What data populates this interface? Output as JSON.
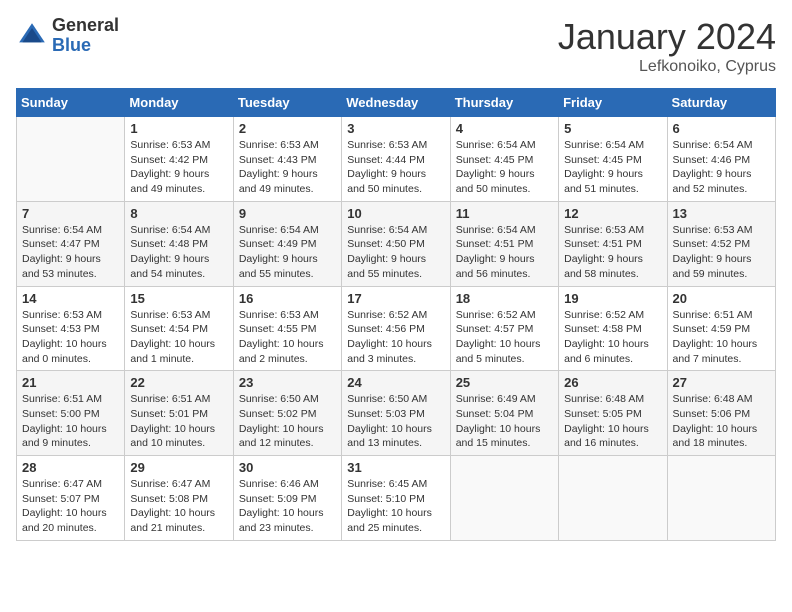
{
  "header": {
    "logo_general": "General",
    "logo_blue": "Blue",
    "month_title": "January 2024",
    "location": "Lefkonoiko, Cyprus"
  },
  "weekdays": [
    "Sunday",
    "Monday",
    "Tuesday",
    "Wednesday",
    "Thursday",
    "Friday",
    "Saturday"
  ],
  "weeks": [
    [
      {
        "day": "",
        "empty": true
      },
      {
        "day": "1",
        "sunrise": "Sunrise: 6:53 AM",
        "sunset": "Sunset: 4:42 PM",
        "daylight": "Daylight: 9 hours and 49 minutes."
      },
      {
        "day": "2",
        "sunrise": "Sunrise: 6:53 AM",
        "sunset": "Sunset: 4:43 PM",
        "daylight": "Daylight: 9 hours and 49 minutes."
      },
      {
        "day": "3",
        "sunrise": "Sunrise: 6:53 AM",
        "sunset": "Sunset: 4:44 PM",
        "daylight": "Daylight: 9 hours and 50 minutes."
      },
      {
        "day": "4",
        "sunrise": "Sunrise: 6:54 AM",
        "sunset": "Sunset: 4:45 PM",
        "daylight": "Daylight: 9 hours and 50 minutes."
      },
      {
        "day": "5",
        "sunrise": "Sunrise: 6:54 AM",
        "sunset": "Sunset: 4:45 PM",
        "daylight": "Daylight: 9 hours and 51 minutes."
      },
      {
        "day": "6",
        "sunrise": "Sunrise: 6:54 AM",
        "sunset": "Sunset: 4:46 PM",
        "daylight": "Daylight: 9 hours and 52 minutes."
      }
    ],
    [
      {
        "day": "7",
        "sunrise": "Sunrise: 6:54 AM",
        "sunset": "Sunset: 4:47 PM",
        "daylight": "Daylight: 9 hours and 53 minutes."
      },
      {
        "day": "8",
        "sunrise": "Sunrise: 6:54 AM",
        "sunset": "Sunset: 4:48 PM",
        "daylight": "Daylight: 9 hours and 54 minutes."
      },
      {
        "day": "9",
        "sunrise": "Sunrise: 6:54 AM",
        "sunset": "Sunset: 4:49 PM",
        "daylight": "Daylight: 9 hours and 55 minutes."
      },
      {
        "day": "10",
        "sunrise": "Sunrise: 6:54 AM",
        "sunset": "Sunset: 4:50 PM",
        "daylight": "Daylight: 9 hours and 55 minutes."
      },
      {
        "day": "11",
        "sunrise": "Sunrise: 6:54 AM",
        "sunset": "Sunset: 4:51 PM",
        "daylight": "Daylight: 9 hours and 56 minutes."
      },
      {
        "day": "12",
        "sunrise": "Sunrise: 6:53 AM",
        "sunset": "Sunset: 4:51 PM",
        "daylight": "Daylight: 9 hours and 58 minutes."
      },
      {
        "day": "13",
        "sunrise": "Sunrise: 6:53 AM",
        "sunset": "Sunset: 4:52 PM",
        "daylight": "Daylight: 9 hours and 59 minutes."
      }
    ],
    [
      {
        "day": "14",
        "sunrise": "Sunrise: 6:53 AM",
        "sunset": "Sunset: 4:53 PM",
        "daylight": "Daylight: 10 hours and 0 minutes."
      },
      {
        "day": "15",
        "sunrise": "Sunrise: 6:53 AM",
        "sunset": "Sunset: 4:54 PM",
        "daylight": "Daylight: 10 hours and 1 minute."
      },
      {
        "day": "16",
        "sunrise": "Sunrise: 6:53 AM",
        "sunset": "Sunset: 4:55 PM",
        "daylight": "Daylight: 10 hours and 2 minutes."
      },
      {
        "day": "17",
        "sunrise": "Sunrise: 6:52 AM",
        "sunset": "Sunset: 4:56 PM",
        "daylight": "Daylight: 10 hours and 3 minutes."
      },
      {
        "day": "18",
        "sunrise": "Sunrise: 6:52 AM",
        "sunset": "Sunset: 4:57 PM",
        "daylight": "Daylight: 10 hours and 5 minutes."
      },
      {
        "day": "19",
        "sunrise": "Sunrise: 6:52 AM",
        "sunset": "Sunset: 4:58 PM",
        "daylight": "Daylight: 10 hours and 6 minutes."
      },
      {
        "day": "20",
        "sunrise": "Sunrise: 6:51 AM",
        "sunset": "Sunset: 4:59 PM",
        "daylight": "Daylight: 10 hours and 7 minutes."
      }
    ],
    [
      {
        "day": "21",
        "sunrise": "Sunrise: 6:51 AM",
        "sunset": "Sunset: 5:00 PM",
        "daylight": "Daylight: 10 hours and 9 minutes."
      },
      {
        "day": "22",
        "sunrise": "Sunrise: 6:51 AM",
        "sunset": "Sunset: 5:01 PM",
        "daylight": "Daylight: 10 hours and 10 minutes."
      },
      {
        "day": "23",
        "sunrise": "Sunrise: 6:50 AM",
        "sunset": "Sunset: 5:02 PM",
        "daylight": "Daylight: 10 hours and 12 minutes."
      },
      {
        "day": "24",
        "sunrise": "Sunrise: 6:50 AM",
        "sunset": "Sunset: 5:03 PM",
        "daylight": "Daylight: 10 hours and 13 minutes."
      },
      {
        "day": "25",
        "sunrise": "Sunrise: 6:49 AM",
        "sunset": "Sunset: 5:04 PM",
        "daylight": "Daylight: 10 hours and 15 minutes."
      },
      {
        "day": "26",
        "sunrise": "Sunrise: 6:48 AM",
        "sunset": "Sunset: 5:05 PM",
        "daylight": "Daylight: 10 hours and 16 minutes."
      },
      {
        "day": "27",
        "sunrise": "Sunrise: 6:48 AM",
        "sunset": "Sunset: 5:06 PM",
        "daylight": "Daylight: 10 hours and 18 minutes."
      }
    ],
    [
      {
        "day": "28",
        "sunrise": "Sunrise: 6:47 AM",
        "sunset": "Sunset: 5:07 PM",
        "daylight": "Daylight: 10 hours and 20 minutes."
      },
      {
        "day": "29",
        "sunrise": "Sunrise: 6:47 AM",
        "sunset": "Sunset: 5:08 PM",
        "daylight": "Daylight: 10 hours and 21 minutes."
      },
      {
        "day": "30",
        "sunrise": "Sunrise: 6:46 AM",
        "sunset": "Sunset: 5:09 PM",
        "daylight": "Daylight: 10 hours and 23 minutes."
      },
      {
        "day": "31",
        "sunrise": "Sunrise: 6:45 AM",
        "sunset": "Sunset: 5:10 PM",
        "daylight": "Daylight: 10 hours and 25 minutes."
      },
      {
        "day": "",
        "empty": true
      },
      {
        "day": "",
        "empty": true
      },
      {
        "day": "",
        "empty": true
      }
    ]
  ]
}
